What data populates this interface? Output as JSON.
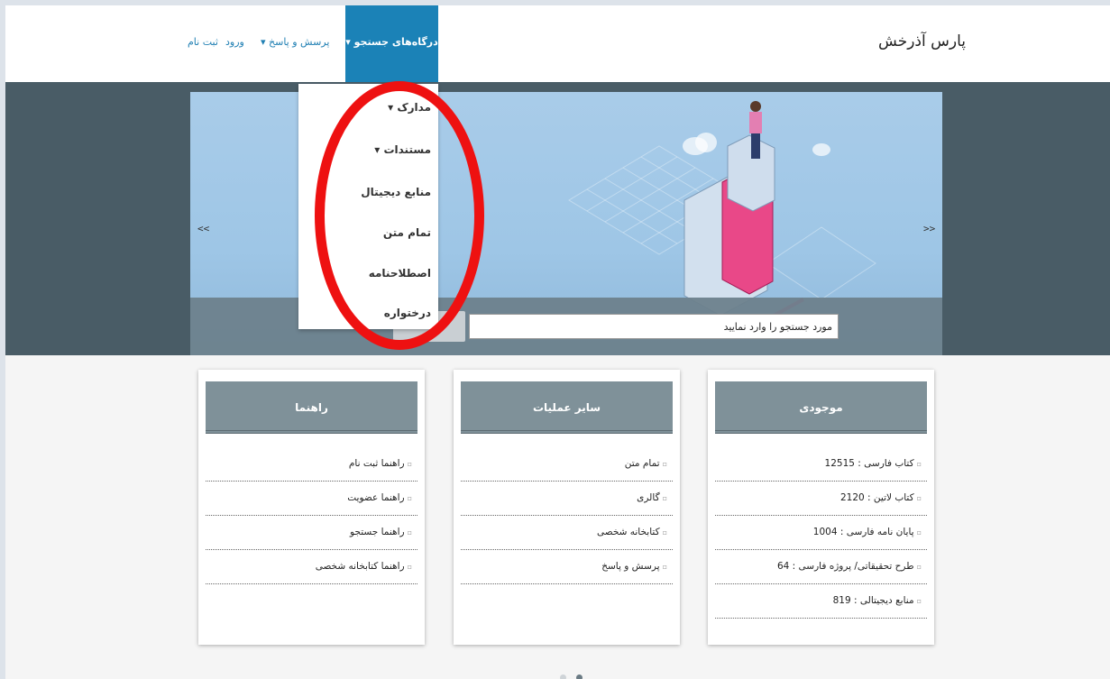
{
  "header": {
    "brand": "پارس آذرخش",
    "nav": {
      "portals": "درگاه‌های جستجو ▾",
      "qa": "پرسش و پاسخ ▾",
      "login": "ورود",
      "register": "ثبت نام"
    }
  },
  "dropdown": {
    "items": [
      "مدارک ▾",
      "مستندات ▾",
      "منابع دیجیتال",
      "تمام متن",
      "اصطلاحنامه",
      "درختواره"
    ]
  },
  "hero": {
    "prev": "<<",
    "next": ">>",
    "search_placeholder": "مورد جستجو را وارد نمایید",
    "search_button": "<"
  },
  "cards": {
    "inventory": {
      "title": "موجودی",
      "rows": [
        "کتاب فارسی : 12515",
        "کتاب لاتین : 2120",
        "پایان نامه فارسی : 1004",
        "طرح تحقیقاتی/ پروژه فارسی : 64",
        "منابع دیجیتالی : 819"
      ]
    },
    "other": {
      "title": "سایر عملیات",
      "rows": [
        "تمام متن",
        "گالری",
        "کتابخانه شخصی",
        "پرسش و پاسخ"
      ]
    },
    "guide": {
      "title": "راهنما",
      "rows": [
        "راهنما ثبت نام",
        "راهنما عضویت",
        "راهنما جستجو",
        "راهنما کتابخانه شخصی"
      ]
    }
  },
  "colors": {
    "nav_active": "#1b82b7",
    "hero_bg": "#495c66",
    "card_head": "#7f9199",
    "highlight_oval": "#ee1111"
  }
}
